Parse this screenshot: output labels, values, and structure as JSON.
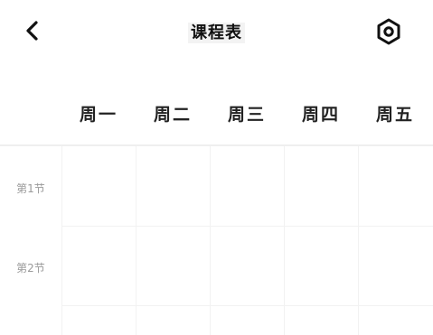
{
  "header": {
    "back_icon": "chevron-left-icon",
    "title": "课程表",
    "settings_icon": "hexagon-settings-icon"
  },
  "days": [
    "周一",
    "周二",
    "周三",
    "周四",
    "周五"
  ],
  "periods": [
    "第1节",
    "第2节"
  ],
  "colors": {
    "text_primary": "#111111",
    "period_label": "#9a9a9a",
    "grid_line": "#f2f2f2"
  }
}
